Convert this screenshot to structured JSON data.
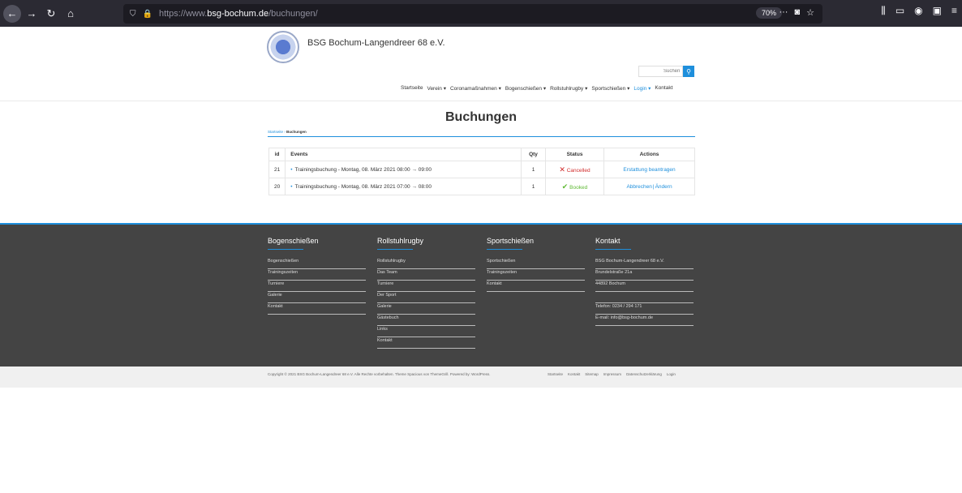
{
  "browser": {
    "url_prefix": "https://www.",
    "url_domain": "bsg-bochum.de",
    "url_path": "/buchungen/",
    "zoom": "70%"
  },
  "site": {
    "title": "BSG Bochum-Langendreer 68 e.V.",
    "search_placeholder": "Suchen"
  },
  "nav": {
    "items": [
      "Startseite",
      "Verein ▾",
      "Coronamaßnahmen ▾",
      "Bogenschießen ▾",
      "Rollstuhlrugby ▾",
      "Sportschießen ▾",
      "Login ▾",
      "Kontakt"
    ]
  },
  "page": {
    "heading": "Buchungen",
    "breadcrumb_home": "Startseite",
    "breadcrumb_sep": " › ",
    "breadcrumb_current": "Buchungen"
  },
  "table": {
    "headers": [
      "id",
      "Events",
      "Qty",
      "Status",
      "Actions"
    ],
    "rows": [
      {
        "id": "21",
        "event": "Trainingsbuchung - Montag, 08. März 2021 08:00 → 09:00",
        "qty": "1",
        "status": "Cancelled",
        "action1": "Erstattung beantragen",
        "action2": ""
      },
      {
        "id": "20",
        "event": "Trainingsbuchung - Montag, 08. März 2021 07:00 → 08:00",
        "qty": "1",
        "status": "Booked",
        "action1": "Abbrechen",
        "action2": "Ändern"
      }
    ]
  },
  "footer": {
    "col1": {
      "title": "Bogenschießen",
      "links": [
        "Bogenschießen",
        "Trainingszeiten",
        "Turniere",
        "Galerie",
        "Kontakt"
      ]
    },
    "col2": {
      "title": "Rollstuhlrugby",
      "links": [
        "Rollstuhlrugby",
        "Das Team",
        "Turniere",
        "Der Sport",
        "Galerie",
        "Gästebuch",
        "Links",
        "Kontakt"
      ]
    },
    "col3": {
      "title": "Sportschießen",
      "links": [
        "Sportschießen",
        "Trainingszeiten",
        "Kontakt"
      ]
    },
    "col4": {
      "title": "Kontakt",
      "lines": [
        "BSG Bochum-Langendreer 68 e.V.",
        "Brundelstraße 21a",
        "44892 Bochum",
        "",
        "Telefon: 0234 / 294 171",
        "E-mail: info@bsg-bochum.de"
      ]
    }
  },
  "bottom": {
    "copyright": "Copyright © 2021 BSG Bochum-Langendreer 68 e.V. Alle Rechte vorbehalten. Theme Spacious von ThemeGrill. Powered by: WordPress.",
    "links": [
      "Startseite",
      "Kontakt",
      "Sitemap",
      "Impressum",
      "Datenschutzerklärung",
      "Login"
    ]
  },
  "colors": {
    "accent": "#1e8fdc",
    "cancelled": "#d12b2b",
    "booked": "#5fb934",
    "footer_bg": "#444444"
  }
}
